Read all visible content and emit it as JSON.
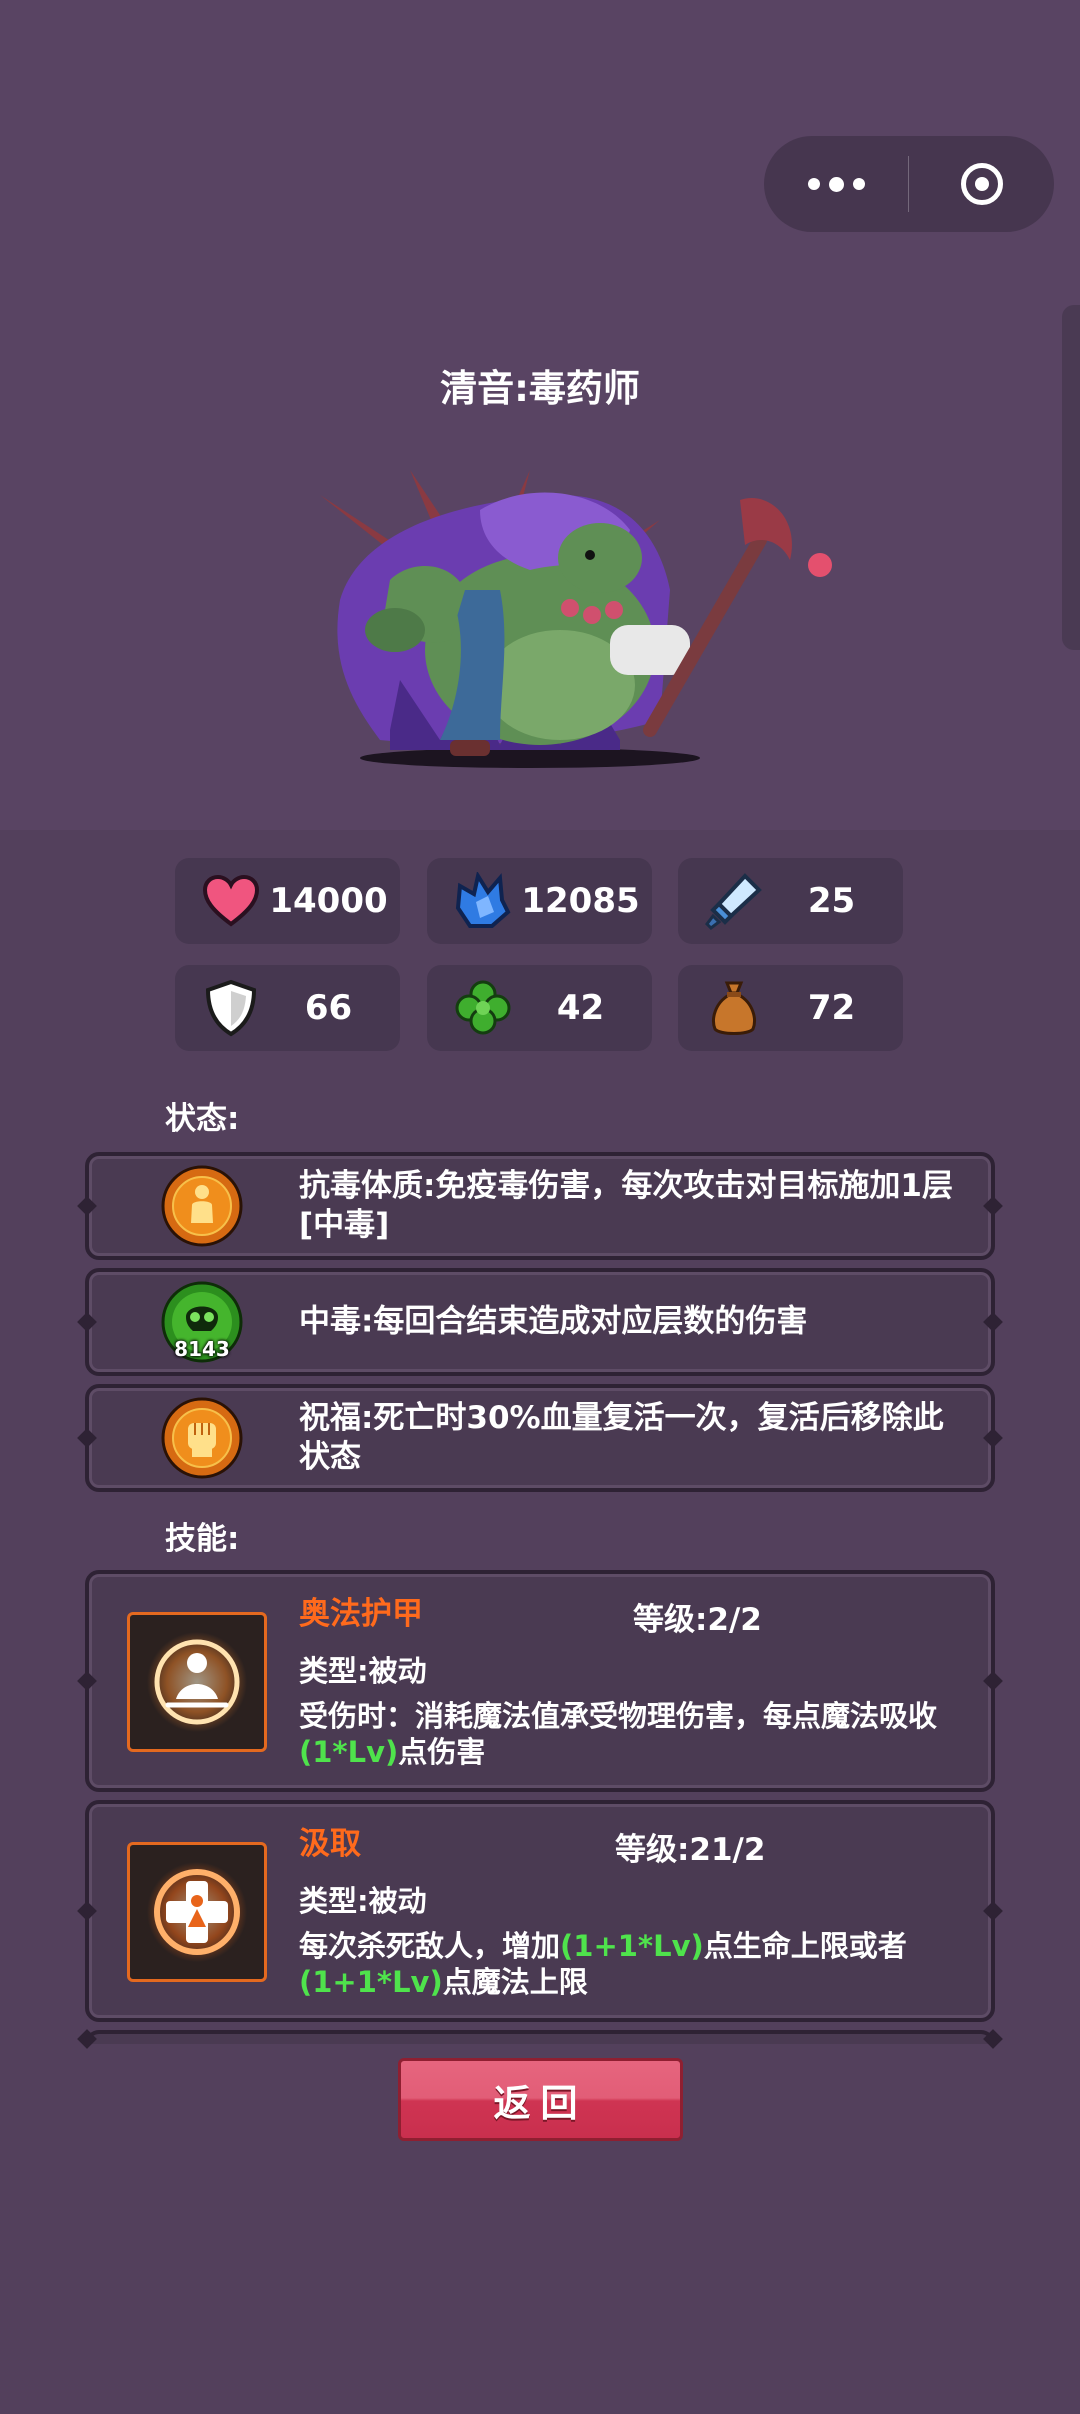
{
  "capsule": {
    "more_icon": "more-dots-icon",
    "close_icon": "target-ring-icon"
  },
  "character": {
    "title": "清音:毒药师"
  },
  "stats": [
    {
      "icon": "heart-icon",
      "value": "14000"
    },
    {
      "icon": "mana-crystal-icon",
      "value": "12085"
    },
    {
      "icon": "sword-icon",
      "value": "25"
    },
    {
      "icon": "shield-icon",
      "value": "66"
    },
    {
      "icon": "clover-icon",
      "value": "42"
    },
    {
      "icon": "money-bag-icon",
      "value": "72"
    }
  ],
  "status": {
    "label": "状态:",
    "items": [
      {
        "icon": "poison-resist-icon",
        "text": "抗毒体质:免疫毒伤害，每次攻击对目标施加1层[中毒]"
      },
      {
        "icon": "poison-skull-icon",
        "badge": "8143",
        "text": "中毒:每回合结束造成对应层数的伤害"
      },
      {
        "icon": "blessing-fist-icon",
        "text": "祝福:死亡时30%血量复活一次，复活后移除此状态"
      }
    ]
  },
  "skills": {
    "label": "技能:",
    "level_prefix": "等级:",
    "items": [
      {
        "icon": "arcane-armor-icon",
        "name": "奥法护甲",
        "level": "2/2",
        "type": "类型:被动",
        "desc_a": "受伤时：消耗魔法值承受物理伤害，每点魔法吸收",
        "desc_hl": "(1*Lv)",
        "desc_b": "点伤害"
      },
      {
        "icon": "drain-icon",
        "name": "汲取",
        "level": "21/2",
        "type": "类型:被动",
        "desc_a": "每次杀死敌人，增加",
        "desc_hl": "(1+1*Lv)",
        "desc_b": "点生命上限或者",
        "desc_hl2": "(1+1*Lv)",
        "desc_c": "点魔法上限"
      }
    ]
  },
  "back_button": {
    "label": "返回"
  },
  "colors": {
    "background": "#53405c",
    "card": "#4a3a52",
    "skill_name": "#ff6a1c",
    "highlight": "#4fe34c",
    "back_button": "#d9445f"
  }
}
